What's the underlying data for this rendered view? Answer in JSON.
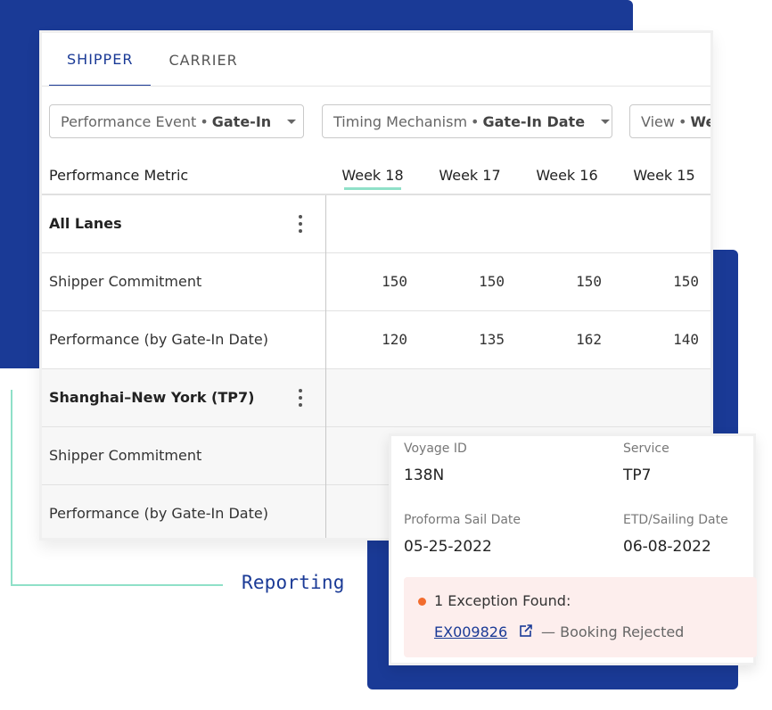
{
  "tabs": [
    {
      "label": "SHIPPER",
      "active": true
    },
    {
      "label": "CARRIER",
      "active": false
    }
  ],
  "filters": [
    {
      "name": "Performance Event",
      "value": "Gate-In"
    },
    {
      "name": "Timing Mechanism",
      "value": "Gate-In Date"
    },
    {
      "name": "View",
      "value": "We"
    }
  ],
  "filter_separator": "•",
  "table": {
    "metric_header": "Performance Metric",
    "weeks": [
      "Week 18",
      "Week 17",
      "Week 16",
      "Week 15"
    ],
    "active_week": "Week 18",
    "groups": [
      {
        "title": "All Lanes",
        "rows": [
          {
            "label": "Shipper Commitment",
            "values": [
              "150",
              "150",
              "150",
              "150"
            ]
          },
          {
            "label": "Performance (by Gate-In Date)",
            "values": [
              "120",
              "135",
              "162",
              "140"
            ]
          }
        ]
      },
      {
        "title": "Shanghai–New York  (TP7)",
        "rows": [
          {
            "label": "Shipper Commitment",
            "values": []
          },
          {
            "label": "Performance (by Gate-In Date)",
            "values": []
          }
        ]
      }
    ]
  },
  "voyage_card": {
    "voyage_id_label": "Voyage ID",
    "voyage_id": "138N",
    "service_label": "Service",
    "service": "TP7",
    "proforma_label": "Proforma Sail Date",
    "proforma_date": "05-25-2022",
    "etd_label": "ETD/Sailing Date",
    "etd_date": "06-08-2022",
    "exception": {
      "title": "1 Exception Found:",
      "id": "EX009826",
      "description": "— Booking Rejected",
      "status_color": "#f26c2e"
    }
  },
  "caption": "Reporting",
  "colors": {
    "brand_blue": "#1a3a96",
    "accent_mint": "#8fe0c8",
    "exception_bg": "#fdeeed"
  }
}
